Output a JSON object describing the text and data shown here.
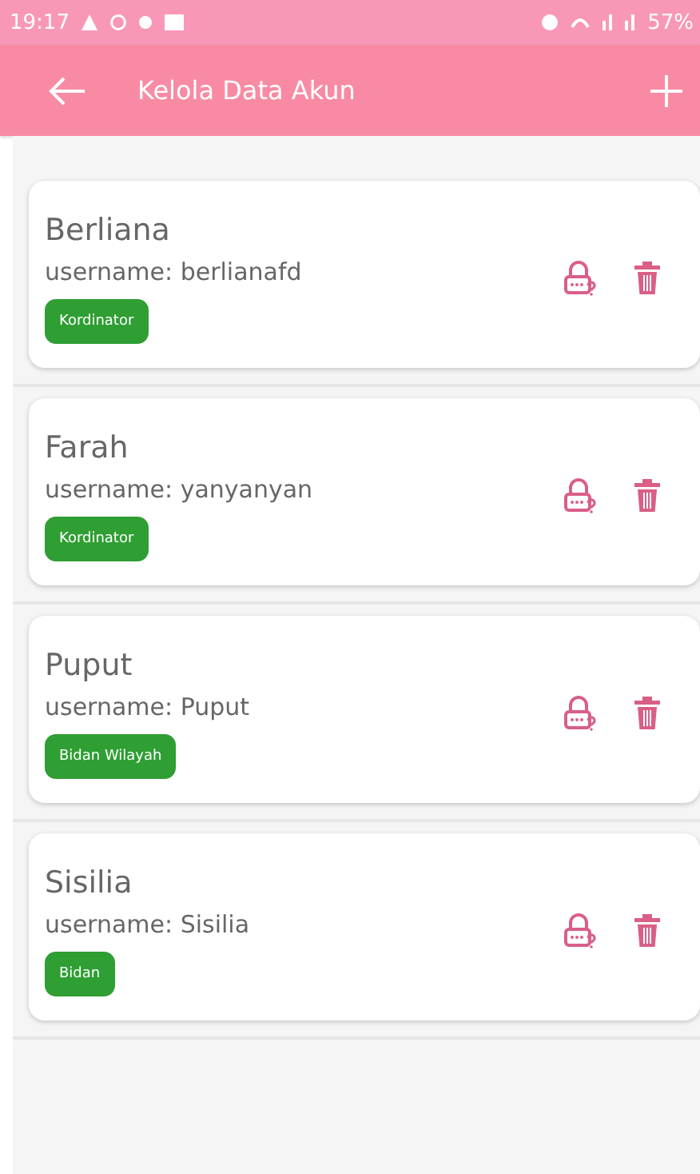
{
  "status_bar": {
    "time": "19:17",
    "battery": "57%"
  },
  "app_bar": {
    "title": "Kelola Data Akun"
  },
  "accounts": [
    {
      "name": "Berliana",
      "username": "username: berlianafd",
      "role": "Kordinator"
    },
    {
      "name": "Farah",
      "username": "username: yanyanyan",
      "role": "Kordinator"
    },
    {
      "name": "Puput",
      "username": "username: Puput",
      "role": "Bidan Wilayah"
    },
    {
      "name": "Sisilia",
      "username": "username: Sisilia",
      "role": "Bidan"
    }
  ]
}
